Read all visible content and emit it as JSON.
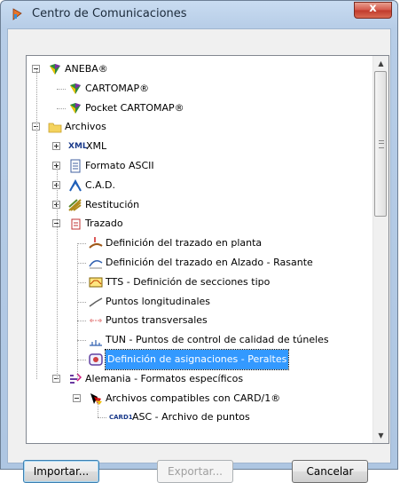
{
  "window": {
    "title": "Centro de Comunicaciones",
    "close_label": "x"
  },
  "tree": [
    {
      "id": "aneba",
      "label": "ANEBA®",
      "icon": "aneba-icon",
      "expander": "minus",
      "level": 0
    },
    {
      "id": "cartomap",
      "label": "CARTOMAP®",
      "icon": "aneba-icon",
      "level": 1
    },
    {
      "id": "pocket-cartomap",
      "label": "Pocket CARTOMAP®",
      "icon": "aneba-icon",
      "level": 1
    },
    {
      "id": "archivos",
      "label": "Archivos",
      "icon": "folder-icon",
      "expander": "minus",
      "level": 0
    },
    {
      "id": "xml",
      "label": "XML",
      "icon_text": "XML",
      "icon": "xml-icon",
      "expander": "plus",
      "level": 1
    },
    {
      "id": "ascii",
      "label": "Formato ASCII",
      "icon": "document-icon",
      "expander": "plus",
      "level": 1
    },
    {
      "id": "cad",
      "label": "C.A.D.",
      "icon": "cad-icon",
      "expander": "plus",
      "level": 1
    },
    {
      "id": "restitucion",
      "label": "Restitución",
      "icon": "restitution-icon",
      "expander": "plus",
      "level": 1
    },
    {
      "id": "trazado",
      "label": "Trazado",
      "icon": "trazado-icon",
      "expander": "minus",
      "level": 1
    },
    {
      "id": "planta",
      "label": "Definición del trazado en planta",
      "icon": "planta-icon",
      "level": 2
    },
    {
      "id": "alzado",
      "label": "Definición del trazado en Alzado - Rasante",
      "icon": "alzado-icon",
      "level": 2
    },
    {
      "id": "tts",
      "label": "TTS - Definición de secciones tipo",
      "icon": "tts-icon",
      "level": 2
    },
    {
      "id": "longitudinales",
      "label": "Puntos longitudinales",
      "icon": "longitudinal-icon",
      "level": 2
    },
    {
      "id": "transversales",
      "label": "Puntos transversales",
      "icon": "transversal-icon",
      "level": 2
    },
    {
      "id": "tun",
      "label": "TUN - Puntos de control de calidad de túneles",
      "icon": "tunnel-icon",
      "level": 2
    },
    {
      "id": "peraltes",
      "label": "Definición de asignaciones - Peraltes",
      "icon": "peraltes-icon",
      "level": 2,
      "selected": true
    },
    {
      "id": "alemania",
      "label": "Alemania - Formatos específicos",
      "icon": "alemania-icon",
      "expander": "minus",
      "level": 1
    },
    {
      "id": "card1",
      "label": "Archivos compatibles con CARD/1®",
      "icon": "germany-icon",
      "expander": "minus",
      "level": 2
    },
    {
      "id": "asc",
      "label": "ASC - Archivo de puntos",
      "icon_text": "CARD1",
      "icon": "card1-icon",
      "level": 3
    }
  ],
  "buttons": {
    "import": "Importar...",
    "export": "Exportar...",
    "cancel": "Cancelar"
  },
  "colors": {
    "selection": "#3399ff",
    "title_bg": "#b9d1ea",
    "close": "#c0392b"
  }
}
